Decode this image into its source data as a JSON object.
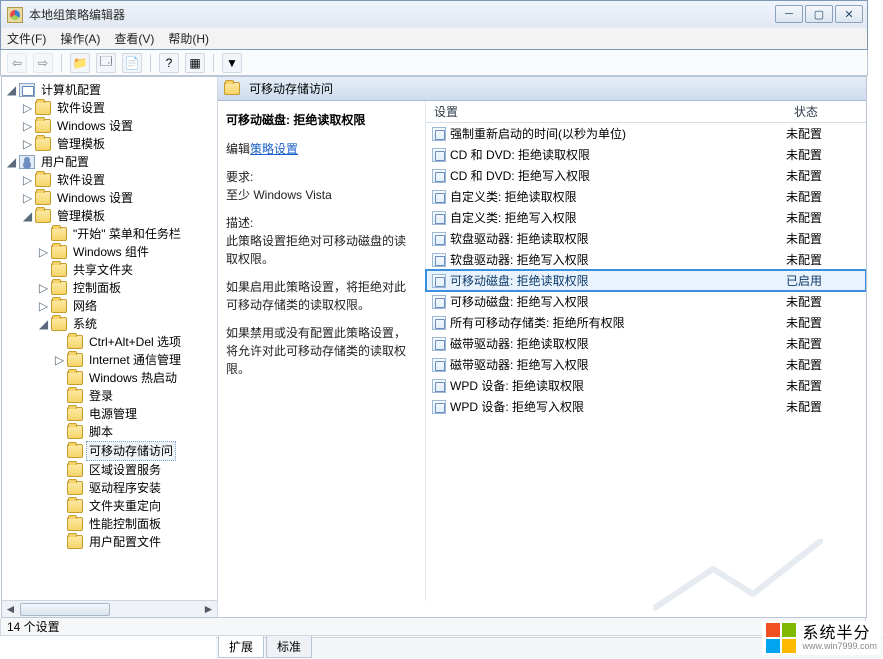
{
  "title": "本地组策略编辑器",
  "menu": {
    "file": "文件(F)",
    "action": "操作(A)",
    "view": "查看(V)",
    "help": "帮助(H)"
  },
  "tree": {
    "computer": "计算机配置",
    "user": "用户配置",
    "software": "软件设置",
    "windows": "Windows 设置",
    "admin": "管理模板",
    "startmenu": "\"开始\" 菜单和任务栏",
    "wincomp": "Windows 组件",
    "shared": "共享文件夹",
    "ctrl": "控制面板",
    "network": "网络",
    "system": "系统",
    "cad": "Ctrl+Alt+Del 选项",
    "ie": "Internet 通信管理",
    "hotstart": "Windows 热启动",
    "logon": "登录",
    "power": "电源管理",
    "script": "脚本",
    "removable": "可移动存储访问",
    "regional": "区域设置服务",
    "drv": "驱动程序安装",
    "folder": "文件夹重定向",
    "perf": "性能控制面板",
    "userprof": "用户配置文件"
  },
  "right": {
    "heading": "可移动存储访问",
    "policy_title": "可移动磁盘: 拒绝读取权限",
    "edit_prefix": "编辑",
    "edit_link": "策略设置",
    "req_label": "要求:",
    "req_value": "至少 Windows Vista",
    "desc_label": "描述:",
    "desc1": "此策略设置拒绝对可移动磁盘的读取权限。",
    "desc2": "如果启用此策略设置，将拒绝对此可移动存储类的读取权限。",
    "desc3": "如果禁用或没有配置此策略设置，将允许对此可移动存储类的读取权限。",
    "col_setting": "设置",
    "col_state": "状态",
    "tab_ext": "扩展",
    "tab_std": "标准"
  },
  "policies": [
    {
      "name": "强制重新启动的时间(以秒为单位)",
      "state": "未配置",
      "hl": false
    },
    {
      "name": "CD 和 DVD: 拒绝读取权限",
      "state": "未配置",
      "hl": false
    },
    {
      "name": "CD 和 DVD: 拒绝写入权限",
      "state": "未配置",
      "hl": false
    },
    {
      "name": "自定义类: 拒绝读取权限",
      "state": "未配置",
      "hl": false
    },
    {
      "name": "自定义类: 拒绝写入权限",
      "state": "未配置",
      "hl": false
    },
    {
      "name": "软盘驱动器: 拒绝读取权限",
      "state": "未配置",
      "hl": false
    },
    {
      "name": "软盘驱动器: 拒绝写入权限",
      "state": "未配置",
      "hl": false
    },
    {
      "name": "可移动磁盘: 拒绝读取权限",
      "state": "已启用",
      "hl": true
    },
    {
      "name": "可移动磁盘: 拒绝写入权限",
      "state": "未配置",
      "hl": false
    },
    {
      "name": "所有可移动存储类: 拒绝所有权限",
      "state": "未配置",
      "hl": false
    },
    {
      "name": "磁带驱动器: 拒绝读取权限",
      "state": "未配置",
      "hl": false
    },
    {
      "name": "磁带驱动器: 拒绝写入权限",
      "state": "未配置",
      "hl": false
    },
    {
      "name": "WPD 设备: 拒绝读取权限",
      "state": "未配置",
      "hl": false
    },
    {
      "name": "WPD 设备: 拒绝写入权限",
      "state": "未配置",
      "hl": false
    }
  ],
  "status": "14 个设置",
  "wm": {
    "brand": "系统半分",
    "url": "www.win7999.com"
  }
}
